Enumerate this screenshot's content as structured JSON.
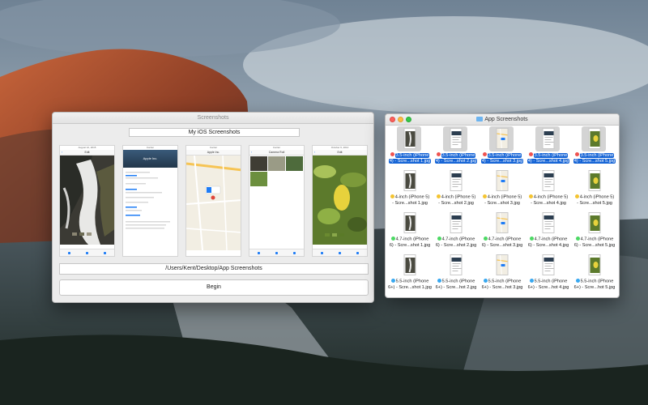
{
  "screenshots_window": {
    "title": "Screenshots",
    "project_name": "My iOS Screenshots",
    "output_path": "/Users/Kent/Desktop/App Screenshots",
    "begin_label": "Begin",
    "previews": [
      {
        "status": "August 12, 2015",
        "nav": "Edit",
        "kind": "photo-waterfall"
      },
      {
        "status": "Carrier",
        "nav": "Apple Inc.",
        "kind": "contact"
      },
      {
        "status": "Carrier",
        "nav": "Apple Inc.",
        "kind": "map"
      },
      {
        "status": "Carrier",
        "nav": "Camera Roll",
        "kind": "album"
      },
      {
        "status": "October 6, 2014",
        "nav": "Edit",
        "kind": "photo-lemon"
      }
    ]
  },
  "finder_window": {
    "title": "App Screenshots",
    "tag_colors": {
      "red": "#ef5350",
      "yellow": "#f4c431",
      "green": "#4cd964",
      "blue": "#38a8f0"
    },
    "files": [
      {
        "line1": "3.5-inch (iPhone",
        "line2": "4) - Scre...shot 1.jpg",
        "tag": "red",
        "selected": true,
        "thumb": "photo"
      },
      {
        "line1": "3.5-inch (iPhone",
        "line2": "4) - Scre...shot 2.jpg",
        "tag": "red",
        "selected": true,
        "thumb": "doc"
      },
      {
        "line1": "3.5-inch (iPhone",
        "line2": "4) - Scre...shot 3.jpg",
        "tag": "red",
        "selected": true,
        "thumb": "map"
      },
      {
        "line1": "3.5-inch (iPhone",
        "line2": "4) - Scre...shot 4.jpg",
        "tag": "red",
        "selected": true,
        "thumb": "doc"
      },
      {
        "line1": "3.5-inch (iPhone",
        "line2": "4) - Scre...shot 5.jpg",
        "tag": "red",
        "selected": true,
        "thumb": "green"
      },
      {
        "line1": "4-inch (iPhone 5)",
        "line2": "- Scre...shot 1.jpg",
        "tag": "yellow",
        "selected": false,
        "thumb": "photo"
      },
      {
        "line1": "4-inch (iPhone 5)",
        "line2": "- Scre...shot 2.jpg",
        "tag": "yellow",
        "selected": false,
        "thumb": "doc"
      },
      {
        "line1": "4-inch (iPhone 5)",
        "line2": "- Scre...shot 3.jpg",
        "tag": "yellow",
        "selected": false,
        "thumb": "map"
      },
      {
        "line1": "4-inch (iPhone 5)",
        "line2": "- Scre...shot 4.jpg",
        "tag": "yellow",
        "selected": false,
        "thumb": "doc"
      },
      {
        "line1": "4-inch (iPhone 5)",
        "line2": "- Scre...shot 5.jpg",
        "tag": "yellow",
        "selected": false,
        "thumb": "green"
      },
      {
        "line1": "4.7-inch (iPhone",
        "line2": "6) - Scre...shot 1.jpg",
        "tag": "green",
        "selected": false,
        "thumb": "photo"
      },
      {
        "line1": "4.7-inch (iPhone",
        "line2": "6) - Scre...shot 2.jpg",
        "tag": "green",
        "selected": false,
        "thumb": "doc"
      },
      {
        "line1": "4.7-inch (iPhone",
        "line2": "6) - Scre...shot 3.jpg",
        "tag": "green",
        "selected": false,
        "thumb": "map"
      },
      {
        "line1": "4.7-inch (iPhone",
        "line2": "6) - Scre...shot 4.jpg",
        "tag": "green",
        "selected": false,
        "thumb": "doc"
      },
      {
        "line1": "4.7-inch (iPhone",
        "line2": "6) - Scre...shot 5.jpg",
        "tag": "green",
        "selected": false,
        "thumb": "green"
      },
      {
        "line1": "5.5-inch (iPhone",
        "line2": "6+) - Scre...shot 1.jpg",
        "tag": "blue",
        "selected": false,
        "thumb": "photo"
      },
      {
        "line1": "5.5-inch (iPhone",
        "line2": "6+) - Scre...hot 2.jpg",
        "tag": "blue",
        "selected": false,
        "thumb": "doc"
      },
      {
        "line1": "5.5-inch (iPhone",
        "line2": "6+) - Scre...hot 3.jpg",
        "tag": "blue",
        "selected": false,
        "thumb": "map"
      },
      {
        "line1": "5.5-inch (iPhone",
        "line2": "6+) - Scre...hot 4.jpg",
        "tag": "blue",
        "selected": false,
        "thumb": "doc"
      },
      {
        "line1": "5.5-inch (iPhone",
        "line2": "6+) - Scre...hot 5.jpg",
        "tag": "blue",
        "selected": false,
        "thumb": "green"
      }
    ]
  }
}
